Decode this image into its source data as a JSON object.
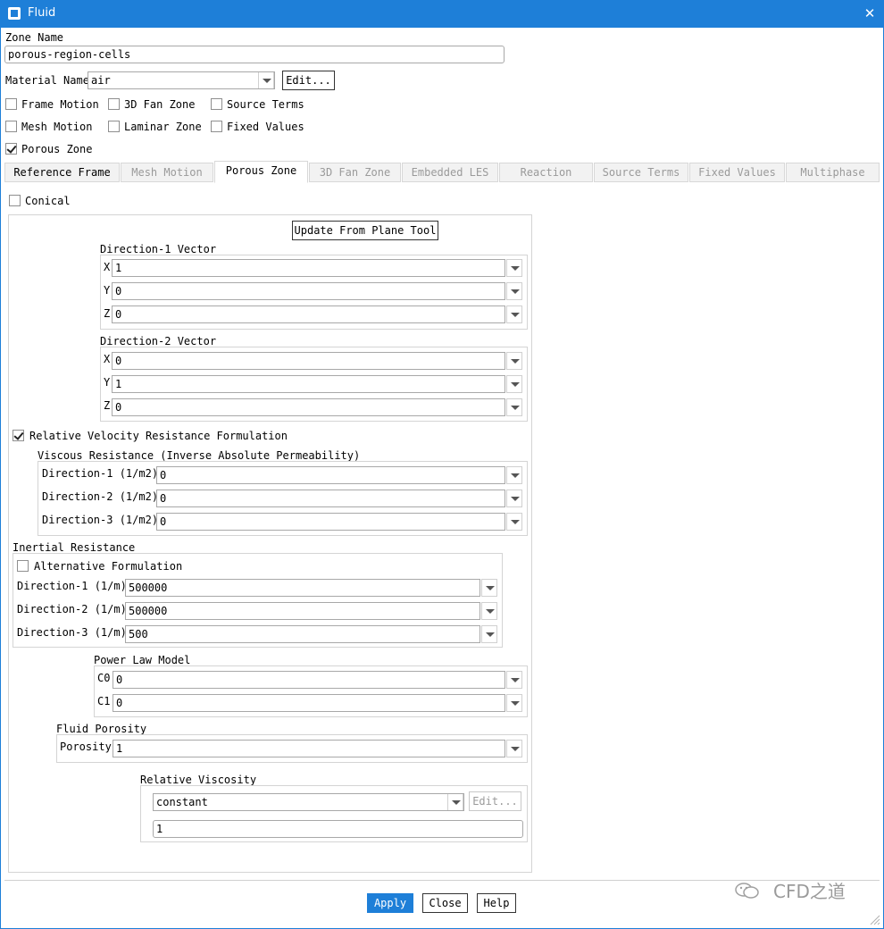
{
  "window": {
    "title": "Fluid",
    "close_glyph": "✕"
  },
  "zone_name": {
    "label": "Zone Name",
    "value": "porous-region-cells"
  },
  "material": {
    "label": "Material Name",
    "value": "air",
    "edit_label": "Edit..."
  },
  "options": [
    {
      "label": "Frame Motion",
      "checked": false
    },
    {
      "label": "3D Fan Zone",
      "checked": false
    },
    {
      "label": "Source Terms",
      "checked": false
    },
    {
      "label": "Mesh Motion",
      "checked": false
    },
    {
      "label": "Laminar Zone",
      "checked": false
    },
    {
      "label": "Fixed Values",
      "checked": false
    },
    {
      "label": "Porous Zone",
      "checked": true
    }
  ],
  "tabs": [
    {
      "label": "Reference Frame",
      "state": "enabled"
    },
    {
      "label": "Mesh Motion",
      "state": "disabled"
    },
    {
      "label": "Porous Zone",
      "state": "active"
    },
    {
      "label": "3D Fan Zone",
      "state": "disabled"
    },
    {
      "label": "Embedded LES",
      "state": "disabled"
    },
    {
      "label": "Reaction",
      "state": "disabled"
    },
    {
      "label": "Source Terms",
      "state": "disabled"
    },
    {
      "label": "Fixed Values",
      "state": "disabled"
    },
    {
      "label": "Multiphase",
      "state": "disabled"
    }
  ],
  "porous": {
    "conical_label": "Conical",
    "update_button": "Update From Plane Tool",
    "direction1": {
      "title": "Direction-1 Vector",
      "x_label": "X",
      "x": "1",
      "y_label": "Y",
      "y": "0",
      "z_label": "Z",
      "z": "0"
    },
    "direction2": {
      "title": "Direction-2 Vector",
      "x_label": "X",
      "x": "0",
      "y_label": "Y",
      "y": "1",
      "z_label": "Z",
      "z": "0"
    },
    "relative_velocity_label": "Relative Velocity Resistance Formulation",
    "viscous": {
      "title": "Viscous Resistance (Inverse Absolute Permeability)",
      "rows": [
        {
          "label": "Direction-1 (1/m2)",
          "value": "0"
        },
        {
          "label": "Direction-2 (1/m2)",
          "value": "0"
        },
        {
          "label": "Direction-3 (1/m2)",
          "value": "0"
        }
      ]
    },
    "inertial": {
      "title": "Inertial Resistance",
      "alt_label": "Alternative Formulation",
      "rows": [
        {
          "label": "Direction-1 (1/m)",
          "value": "500000"
        },
        {
          "label": "Direction-2 (1/m)",
          "value": "500000"
        },
        {
          "label": "Direction-3 (1/m)",
          "value": "500"
        }
      ]
    },
    "power_law": {
      "title": "Power Law Model",
      "c0_label": "C0",
      "c0": "0",
      "c1_label": "C1",
      "c1": "0"
    },
    "fluid_porosity": {
      "title": "Fluid Porosity",
      "label": "Porosity",
      "value": "1"
    },
    "relative_viscosity": {
      "title": "Relative Viscosity",
      "method": "constant",
      "edit_label": "Edit...",
      "value": "1"
    }
  },
  "buttons": {
    "apply": "Apply",
    "close": "Close",
    "help": "Help"
  },
  "watermark": "CFD之道",
  "colors": {
    "titlebar": "#1e7fd8",
    "apply_bg": "#1e7fd8"
  }
}
